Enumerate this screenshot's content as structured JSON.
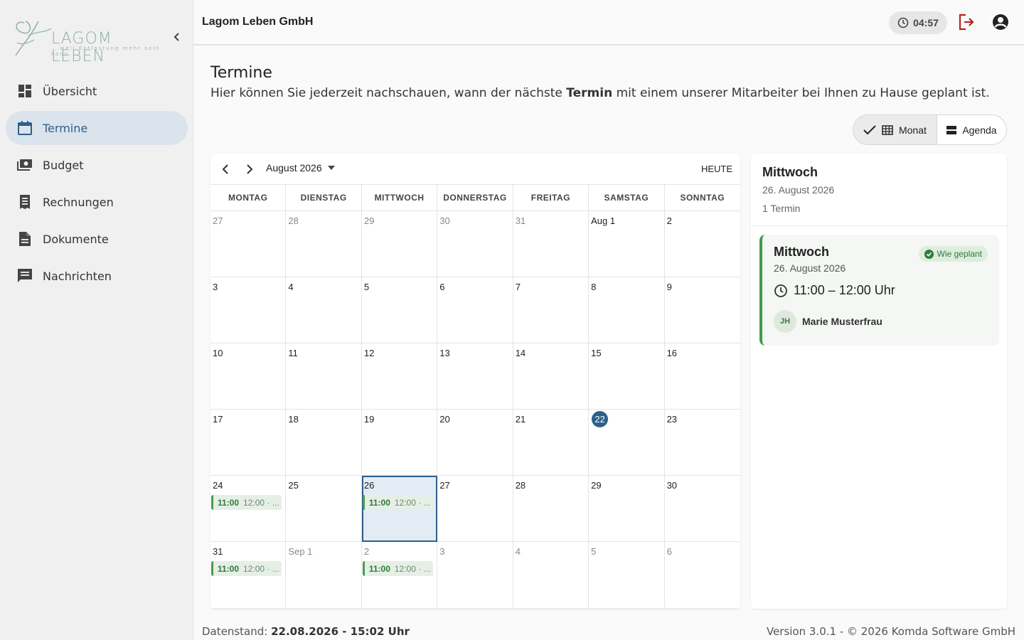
{
  "brand": {
    "logo_name": "LAGOM LEBEN",
    "logo_tagline": "...weil Entlastung mehr sein kann."
  },
  "sidebar": {
    "items": [
      {
        "label": "Übersicht",
        "icon": "dashboard-icon",
        "active": false
      },
      {
        "label": "Termine",
        "icon": "calendar-icon",
        "active": true
      },
      {
        "label": "Budget",
        "icon": "money-icon",
        "active": false
      },
      {
        "label": "Rechnungen",
        "icon": "receipt-icon",
        "active": false
      },
      {
        "label": "Dokumente",
        "icon": "document-icon",
        "active": false
      },
      {
        "label": "Nachrichten",
        "icon": "message-icon",
        "active": false
      }
    ]
  },
  "header": {
    "company": "Lagom Leben GmbH",
    "timer": "04:57"
  },
  "page": {
    "title": "Termine",
    "desc_before": "Hier können Sie jederzeit nachschauen, wann der nächste ",
    "desc_bold": "Termin",
    "desc_after": " mit einem unserer Mitarbeiter bei Ihnen zu Hause geplant ist."
  },
  "view_toggle": {
    "month_label": "Monat",
    "agenda_label": "Agenda",
    "selected": "Monat"
  },
  "calendar": {
    "month_label": "August 2026",
    "today_label": "HEUTE",
    "weekdays": [
      "MONTAG",
      "DIENSTAG",
      "MITTWOCH",
      "DONNERSTAG",
      "FREITAG",
      "SAMSTAG",
      "SONNTAG"
    ],
    "weeks": [
      [
        {
          "d": "27",
          "other": true
        },
        {
          "d": "28",
          "other": true
        },
        {
          "d": "29",
          "other": true
        },
        {
          "d": "30",
          "other": true
        },
        {
          "d": "31",
          "other": true
        },
        {
          "d": "Aug 1"
        },
        {
          "d": "2"
        }
      ],
      [
        {
          "d": "3"
        },
        {
          "d": "4"
        },
        {
          "d": "5"
        },
        {
          "d": "6"
        },
        {
          "d": "7"
        },
        {
          "d": "8"
        },
        {
          "d": "9"
        }
      ],
      [
        {
          "d": "10"
        },
        {
          "d": "11"
        },
        {
          "d": "12"
        },
        {
          "d": "13"
        },
        {
          "d": "14"
        },
        {
          "d": "15"
        },
        {
          "d": "16"
        }
      ],
      [
        {
          "d": "17"
        },
        {
          "d": "18"
        },
        {
          "d": "19"
        },
        {
          "d": "20"
        },
        {
          "d": "21"
        },
        {
          "d": "22",
          "today": true
        },
        {
          "d": "23"
        }
      ],
      [
        {
          "d": "24",
          "event": {
            "start": "11:00",
            "rest": "12:00 · ..."
          }
        },
        {
          "d": "25"
        },
        {
          "d": "26",
          "selected": true,
          "event": {
            "start": "11:00",
            "rest": "12:00 · ..."
          }
        },
        {
          "d": "27"
        },
        {
          "d": "28"
        },
        {
          "d": "29"
        },
        {
          "d": "30"
        }
      ],
      [
        {
          "d": "31",
          "event": {
            "start": "11:00",
            "rest": "12:00 · ..."
          }
        },
        {
          "d": "Sep 1",
          "other": true
        },
        {
          "d": "2",
          "other": true,
          "event": {
            "start": "11:00",
            "rest": "12:00 · ..."
          }
        },
        {
          "d": "3",
          "other": true
        },
        {
          "d": "4",
          "other": true
        },
        {
          "d": "5",
          "other": true
        },
        {
          "d": "6",
          "other": true
        }
      ]
    ]
  },
  "day_panel": {
    "weekday": "Mittwoch",
    "date": "26. August 2026",
    "count": "1 Termin",
    "appointment": {
      "title": "Mittwoch",
      "date": "26. August 2026",
      "status": "Wie geplant",
      "time": "11:00 – 12:00 Uhr",
      "avatar_initials": "JH",
      "person": "Marie Musterfrau"
    }
  },
  "footer": {
    "data_label": "Datenstand: ",
    "data_value": "22.08.2026 - 15:02 Uhr",
    "version": "Version 3.0.1 - © 2026 Komda Software GmbH"
  },
  "colors": {
    "primary": "#2d5f8b",
    "event_green": "#4a9a55",
    "logout_red": "#b3261e"
  }
}
